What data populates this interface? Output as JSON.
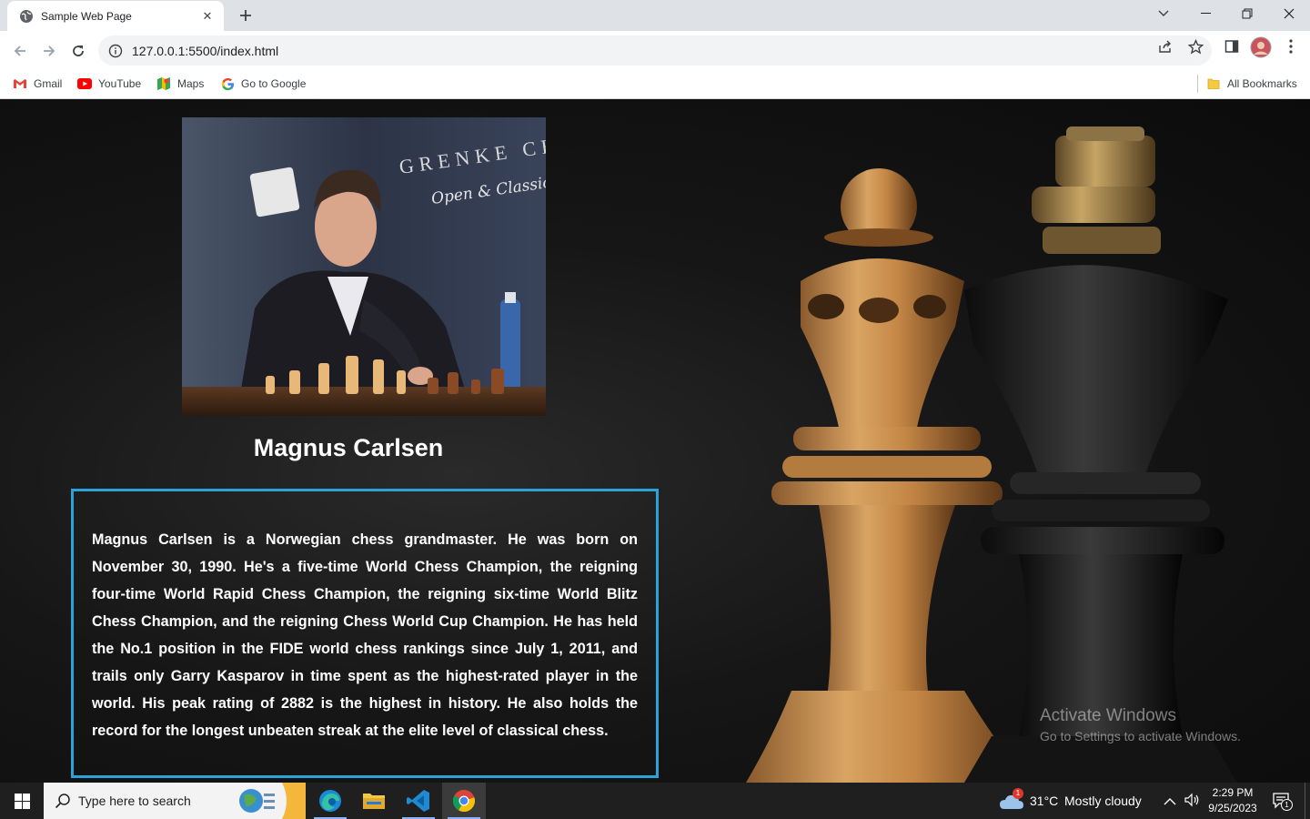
{
  "browser": {
    "tab_title": "Sample Web Page",
    "url": "127.0.0.1:5500/index.html",
    "bookmarks": [
      {
        "label": "Gmail",
        "icon": "gmail-icon"
      },
      {
        "label": "YouTube",
        "icon": "youtube-icon"
      },
      {
        "label": "Maps",
        "icon": "maps-icon"
      },
      {
        "label": "Go to Google",
        "icon": "google-icon"
      }
    ],
    "all_bookmarks_label": "All Bookmarks"
  },
  "page": {
    "heading": "Magnus Carlsen",
    "bio": "Magnus Carlsen is a Norwegian chess grandmaster. He was born on November 30, 1990. He's a five-time World Chess Champion, the reigning four-time World Rapid Chess Champion, the reigning six-time World Blitz Chess Champion, and the reigning Chess World Cup Champion. He has held the No.1 position in the FIDE world chess rankings since July 1, 2011, and trails only Garry Kasparov in time spent as the highest-rated player in the world. His peak rating of 2882 is the highest in history. He also holds the record for the longest unbeaten streak at the elite level of classical chess.",
    "photo_banner_text": "GRENKE CHE",
    "photo_banner_sub": "Open & Classic",
    "accent_color": "#2aa4d8"
  },
  "watermark": {
    "line1": "Activate Windows",
    "line2": "Go to Settings to activate Windows."
  },
  "taskbar": {
    "search_placeholder": "Type here to search",
    "weather_temp": "31°C",
    "weather_desc": "Mostly cloudy",
    "weather_badge": "1",
    "time": "2:29 PM",
    "date": "9/25/2023",
    "notification_count": "1",
    "apps": [
      "widgets-icon",
      "edge-icon",
      "file-explorer-icon",
      "vscode-icon",
      "chrome-icon"
    ]
  }
}
